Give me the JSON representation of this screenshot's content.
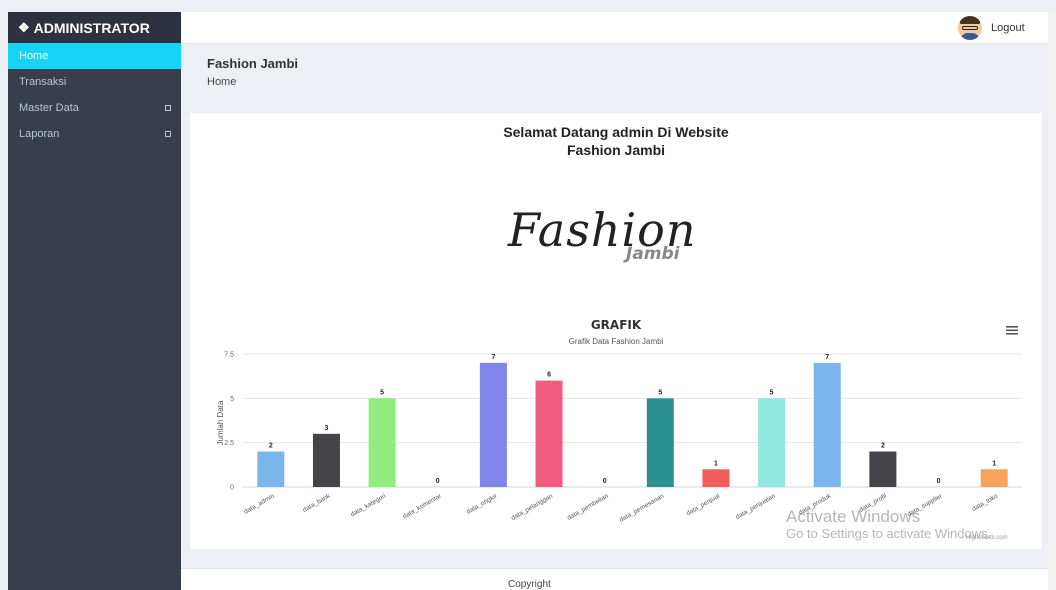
{
  "sidebar": {
    "brand": "ADMINISTRATOR",
    "brand_icon": "brand-logo-icon",
    "items": [
      {
        "label": "Home",
        "active": true,
        "has_submenu": false
      },
      {
        "label": "Transaksi",
        "active": false,
        "has_submenu": false
      },
      {
        "label": "Master Data",
        "active": false,
        "has_submenu": true
      },
      {
        "label": "Laporan",
        "active": false,
        "has_submenu": true
      }
    ]
  },
  "topbar": {
    "avatar_icon": "user-avatar-icon",
    "logout_label": "Logout"
  },
  "page": {
    "title": "Fashion Jambi",
    "breadcrumb": "Home"
  },
  "welcome": {
    "line1": "Selamat Datang admin Di Website",
    "line2": "Fashion Jambi"
  },
  "logo": {
    "main": "Fashion",
    "sub": "Jambi"
  },
  "chart_data": {
    "type": "bar",
    "title": "GRAFIK",
    "subtitle": "Grafik Data Fashion Jambi",
    "ylabel": "Jumlah Data",
    "ylim": [
      0,
      7.5
    ],
    "yticks": [
      "0",
      "2.5",
      "5",
      "7.5"
    ],
    "categories": [
      "data_admin",
      "data_bank",
      "data_kategori",
      "data_komentar",
      "data_ongkir",
      "data_pelanggan",
      "data_pembelian",
      "data_pemesanan",
      "data_penjual",
      "data_penjualan",
      "data_produk",
      "data_profil",
      "data_supplier",
      "data_toko"
    ],
    "values": [
      2,
      3,
      5,
      0,
      7,
      6,
      0,
      5,
      1,
      5,
      7,
      2,
      0,
      1
    ],
    "colors": [
      "#7cb5ec",
      "#434348",
      "#90ed7d",
      "#f7a35c",
      "#8085e9",
      "#f15c80",
      "#e4d354",
      "#2b908f",
      "#f45b5b",
      "#91e8e1",
      "#7cb5ec",
      "#434348",
      "#90ed7d",
      "#f7a35c"
    ],
    "grid": true,
    "legend": "none",
    "menu_icon": "hamburger-menu-icon",
    "credits": "Highcharts.com"
  },
  "watermark": {
    "line1": "Activate Windows",
    "line2": "Go to Settings to activate Windows."
  },
  "footer": {
    "text": "Copyright"
  }
}
